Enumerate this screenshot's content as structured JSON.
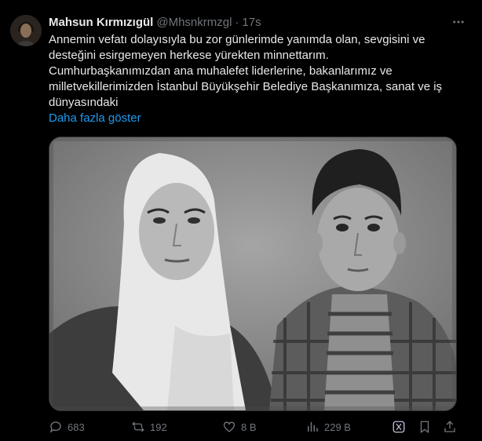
{
  "tweet": {
    "author_name": "Mahsun Kırmızıgül",
    "handle": "@Mhsnkrmzgl",
    "separator": "·",
    "time": "17s",
    "text_lines": [
      "Annemin vefatı dolayısıyla bu zor günlerimde yanımda olan, sevgisini ve",
      "desteğini esirgemeyen herkese yürekten minnettarım.",
      "Cumhurbaşkanımızdan ana muhalefet liderlerine, bakanlarımız ve",
      "milletvekillerimizden İstanbul Büyükşehir Belediye Başkanımıza, sanat ve iş",
      "dünyasındaki"
    ],
    "show_more": "Daha fazla göster"
  },
  "actions": {
    "replies": "683",
    "reposts": "192",
    "likes": "8 B",
    "views": "229 B"
  },
  "icons": {
    "avatar": "profile-photo",
    "more": "more-horizontal-icon",
    "reply": "reply-icon",
    "repost": "repost-icon",
    "like": "heart-icon",
    "views": "views-chart-icon",
    "grok": "grok-icon",
    "bookmark": "bookmark-icon",
    "share": "share-icon"
  },
  "colors": {
    "background": "#000000",
    "text": "#e7e9ea",
    "secondary": "#71767b",
    "link": "#1d9bf0"
  }
}
